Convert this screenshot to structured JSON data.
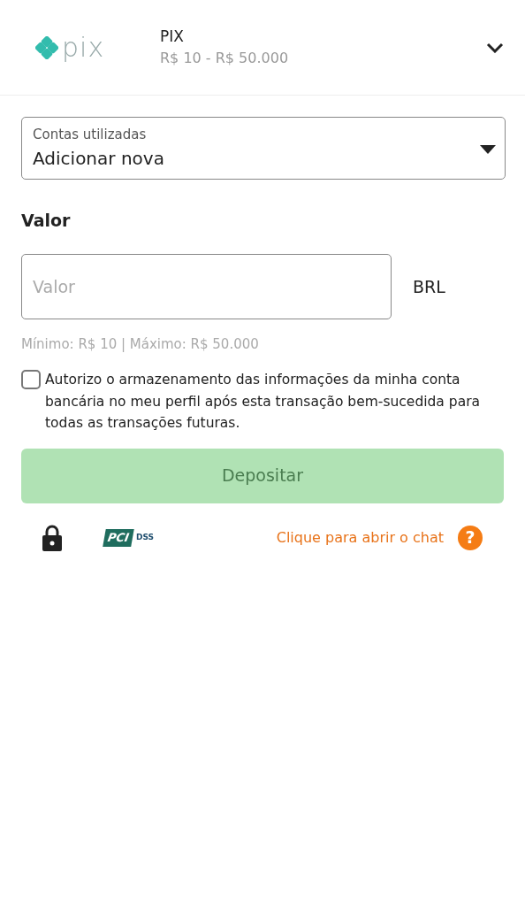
{
  "method": {
    "logo_text": "pix",
    "name": "PIX",
    "range": "R$ 10 - R$ 50.000",
    "expanded": false
  },
  "account_select": {
    "label": "Contas utilizadas",
    "value": "Adicionar nova"
  },
  "amount": {
    "heading": "Valor",
    "placeholder": "Valor",
    "currency": "BRL",
    "limits": "Mínimo: R$ 10 | Máximo: R$ 50.000"
  },
  "consent": {
    "checked": false,
    "text": "Autorizo o armazenamento das informações da minha conta bancária no meu perfil após esta transação bem-sucedida para todas as transações futuras."
  },
  "submit": {
    "label": "Depositar",
    "disabled": true
  },
  "footer": {
    "pci_mark": "PCI",
    "pci_label": "DSS",
    "chat_link": "Clique para abrir o chat",
    "help_icon": "?"
  }
}
